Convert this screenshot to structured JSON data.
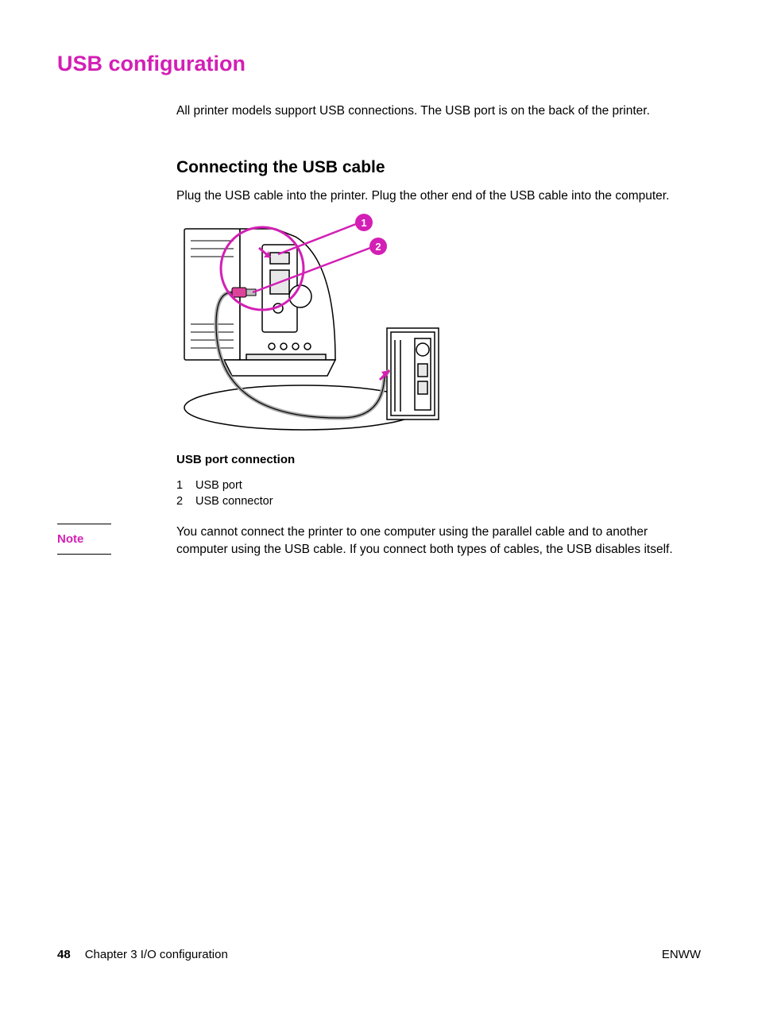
{
  "title": "USB configuration",
  "intro": "All printer models support USB connections. The USB port is on the back of the printer.",
  "section": {
    "heading": "Connecting the USB cable",
    "text": "Plug the USB cable into the printer. Plug the other end of the USB cable into the computer.",
    "figure_caption": "USB port connection",
    "legend": [
      {
        "num": "1",
        "label": "USB port"
      },
      {
        "num": "2",
        "label": "USB connector"
      }
    ]
  },
  "note": {
    "label": "Note",
    "text": "You cannot connect the printer to one computer using the parallel cable and to another computer using the USB cable. If you connect both types of cables, the USB disables itself."
  },
  "footer": {
    "page": "48",
    "chapter": "Chapter 3   I/O configuration",
    "right": "ENWW"
  },
  "callouts": {
    "c1": "1",
    "c2": "2"
  }
}
